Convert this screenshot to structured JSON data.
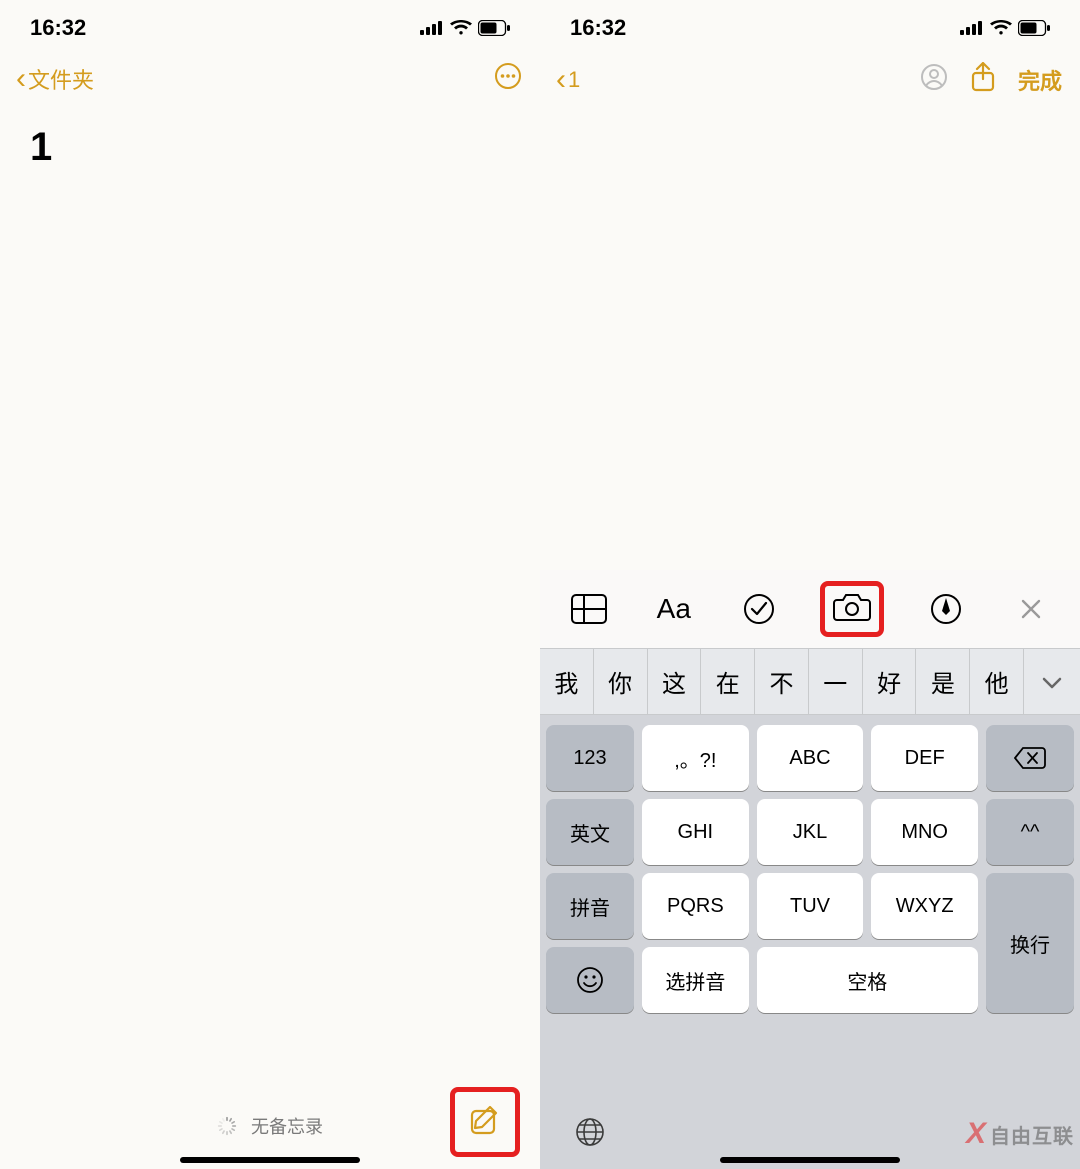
{
  "status": {
    "time": "16:32"
  },
  "left": {
    "back_label": "文件夹",
    "note_title": "1",
    "empty_label": "无备忘录"
  },
  "right": {
    "back_label": "1",
    "done_label": "完成",
    "format_bar": {
      "aa": "Aa"
    },
    "suggestions": [
      "我",
      "你",
      "这",
      "在",
      "不",
      "一",
      "好",
      "是",
      "他"
    ],
    "keys": {
      "num": "123",
      "punct": ",。?!",
      "abc": "ABC",
      "def": "DEF",
      "en": "英文",
      "ghi": "GHI",
      "jkl": "JKL",
      "mno": "MNO",
      "smile": "^^",
      "pinyin": "拼音",
      "pqrs": "PQRS",
      "tuv": "TUV",
      "wxyz": "WXYZ",
      "enter": "换行",
      "select_pinyin": "选拼音",
      "space": "空格"
    }
  },
  "watermark": "自由互联"
}
